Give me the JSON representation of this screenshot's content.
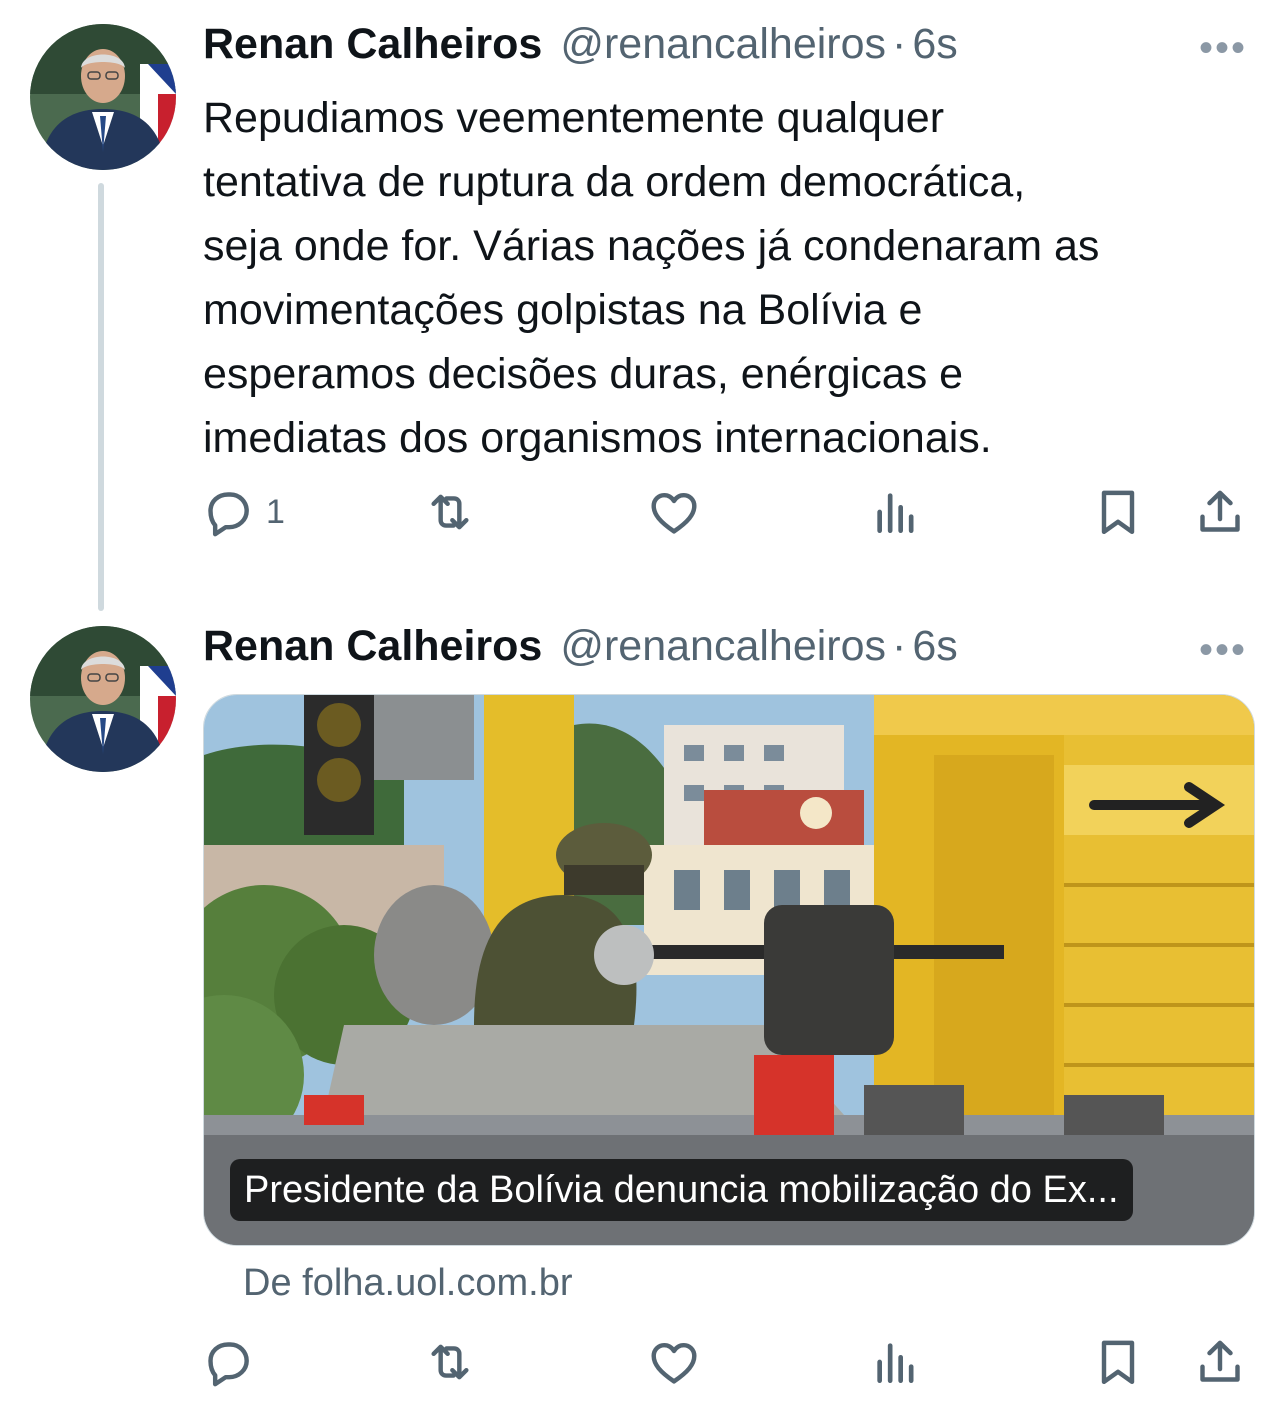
{
  "tweets": [
    {
      "author_name": "Renan Calheiros",
      "handle": "@renancalheiros",
      "separator": "·",
      "time": "6s",
      "more_label": "•••",
      "text_lines": [
        "Repudiamos veementemente qualquer",
        "tentativa de ruptura da ordem democrática,",
        "seja onde for. Várias nações já condenaram as",
        "movimentações golpistas na Bolívia e",
        "esperamos decisões duras, enérgicas e",
        "imediatas dos organismos internacionais."
      ],
      "actions": {
        "reply_count": "1"
      }
    },
    {
      "author_name": "Renan Calheiros",
      "handle": "@renancalheiros",
      "separator": "·",
      "time": "6s",
      "more_label": "•••",
      "card": {
        "caption": "Presidente da Bolívia denuncia mobilização do Ex...",
        "source": "De folha.uol.com.br"
      },
      "actions": {
        "reply_count": ""
      }
    }
  ],
  "icons": {
    "reply": "reply-icon",
    "retweet": "retweet-icon",
    "like": "heart-icon",
    "views": "views-icon",
    "bookmark": "bookmark-icon",
    "share": "share-icon"
  },
  "colors": {
    "text": "#0f1419",
    "secondary": "#536471",
    "thread_line": "#cfd9de"
  }
}
